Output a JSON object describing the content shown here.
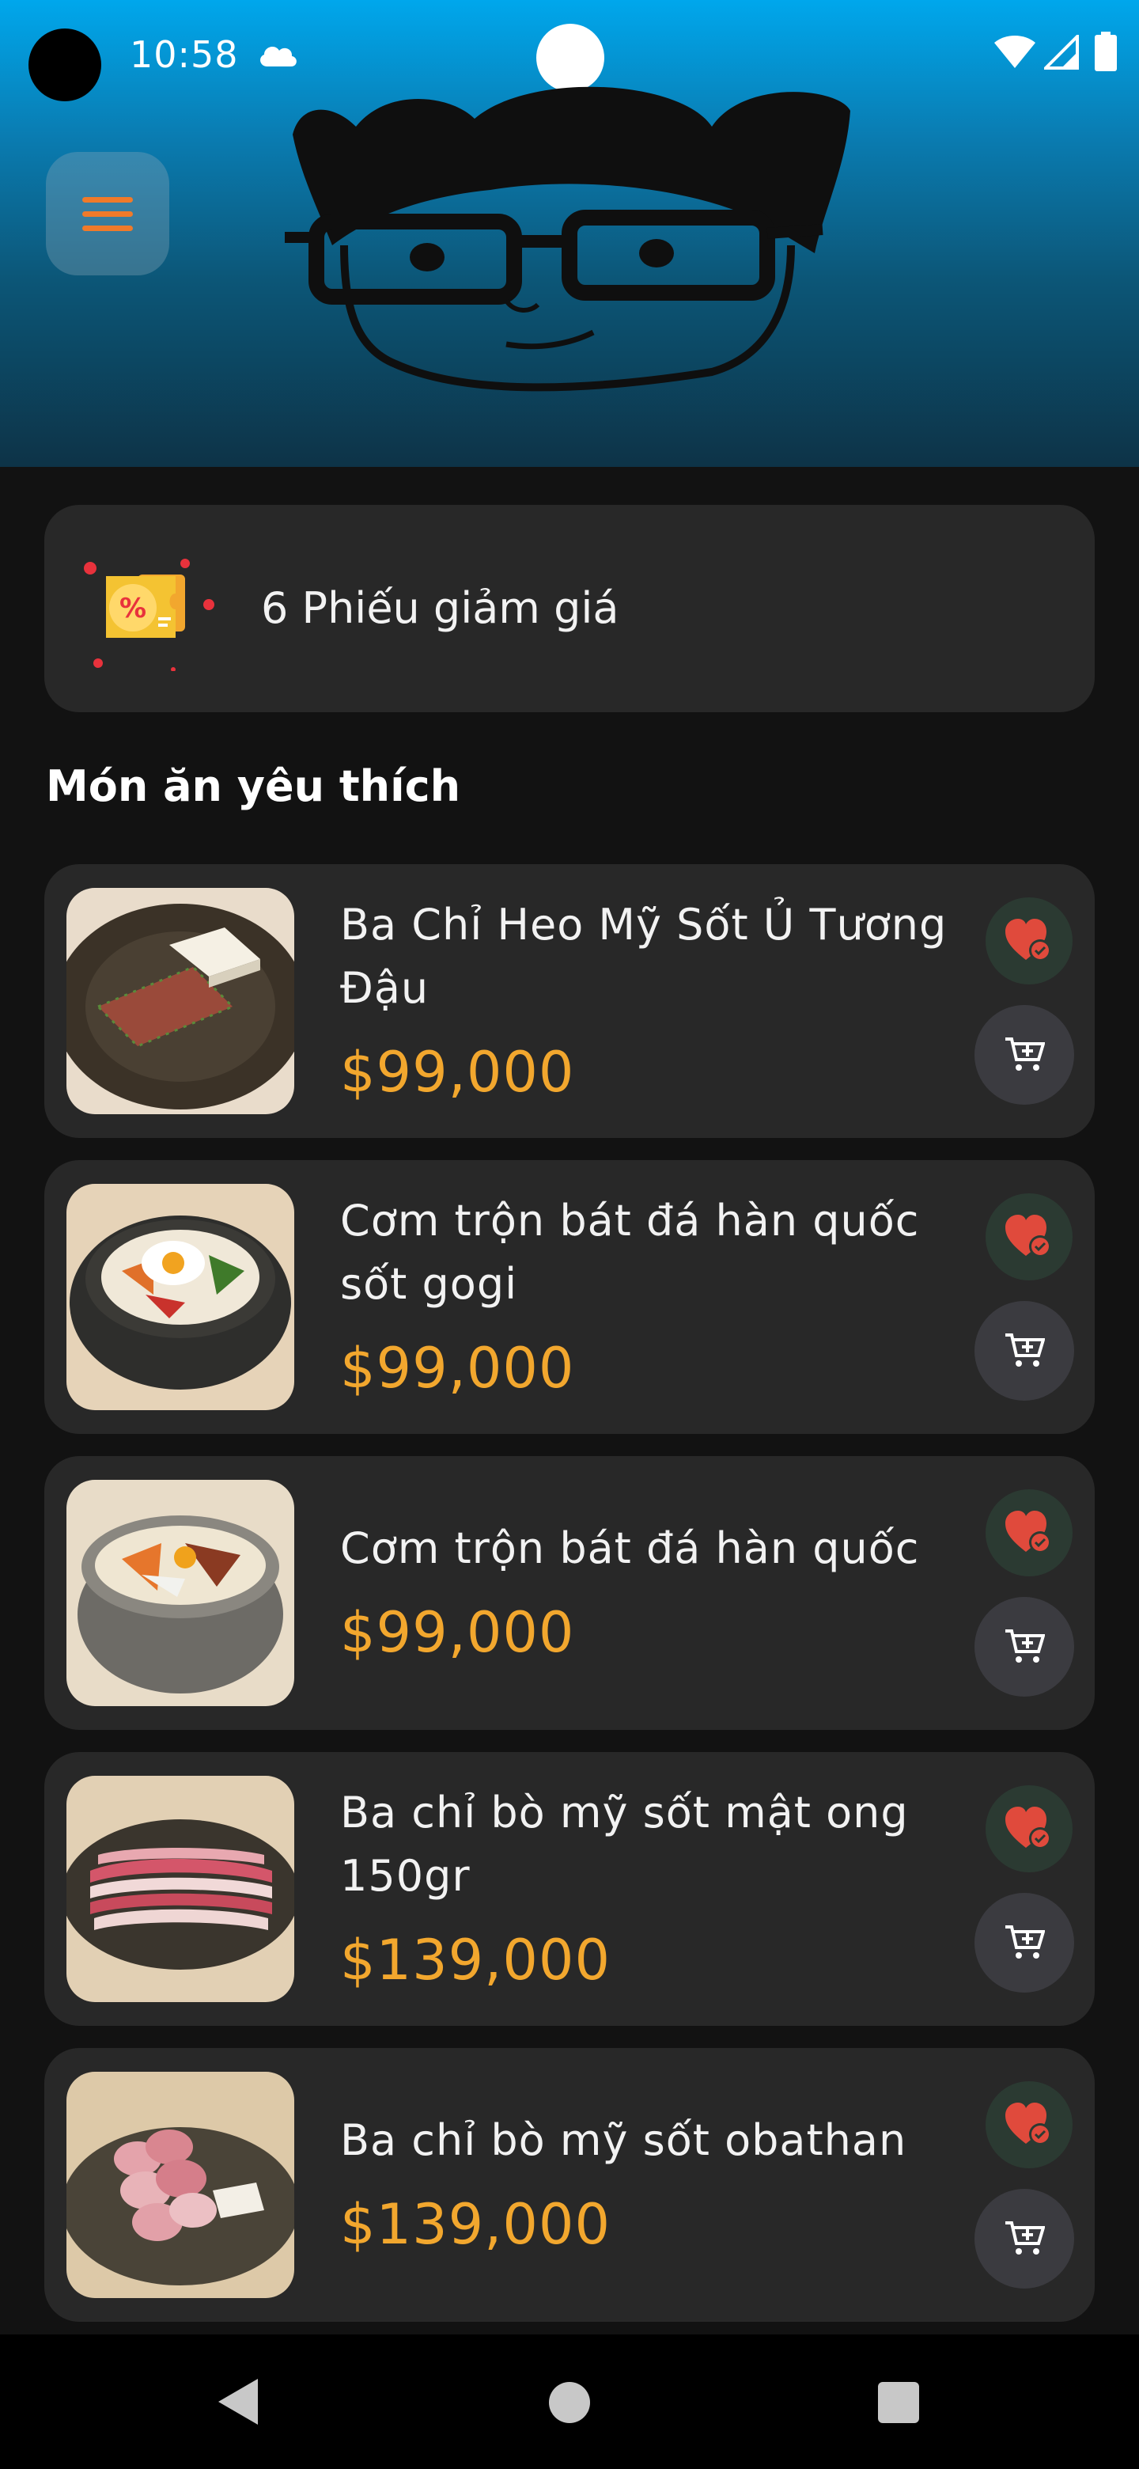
{
  "status_bar": {
    "time": "10:58"
  },
  "icons": {
    "menu": "hamburger-menu-icon",
    "voucher": "discount-voucher-icon",
    "favorite": "heart-check-icon",
    "cart": "add-to-cart-icon"
  },
  "colors": {
    "accent_price": "#f2a72e",
    "menu_icon": "#f07a2a",
    "favorite_heart": "#e04a3c",
    "card_bg": "#282828",
    "page_bg": "#121212"
  },
  "voucher": {
    "label": "6 Phiếu giảm giá"
  },
  "favorites": {
    "title": "Món ăn yêu thích",
    "items": [
      {
        "name": "Ba Chỉ Heo Mỹ Sốt Ủ Tương Đậu",
        "price": "$99,000"
      },
      {
        "name": "Cơm trộn bát đá hàn quốc sốt gogi",
        "price": "$99,000"
      },
      {
        "name": "Cơm trộn bát đá hàn quốc",
        "price": "$99,000"
      },
      {
        "name": "Ba chỉ bò mỹ sốt mật ong 150gr",
        "price": "$139,000"
      },
      {
        "name": "Ba chỉ bò mỹ sốt obathan",
        "price": "$139,000"
      }
    ]
  }
}
